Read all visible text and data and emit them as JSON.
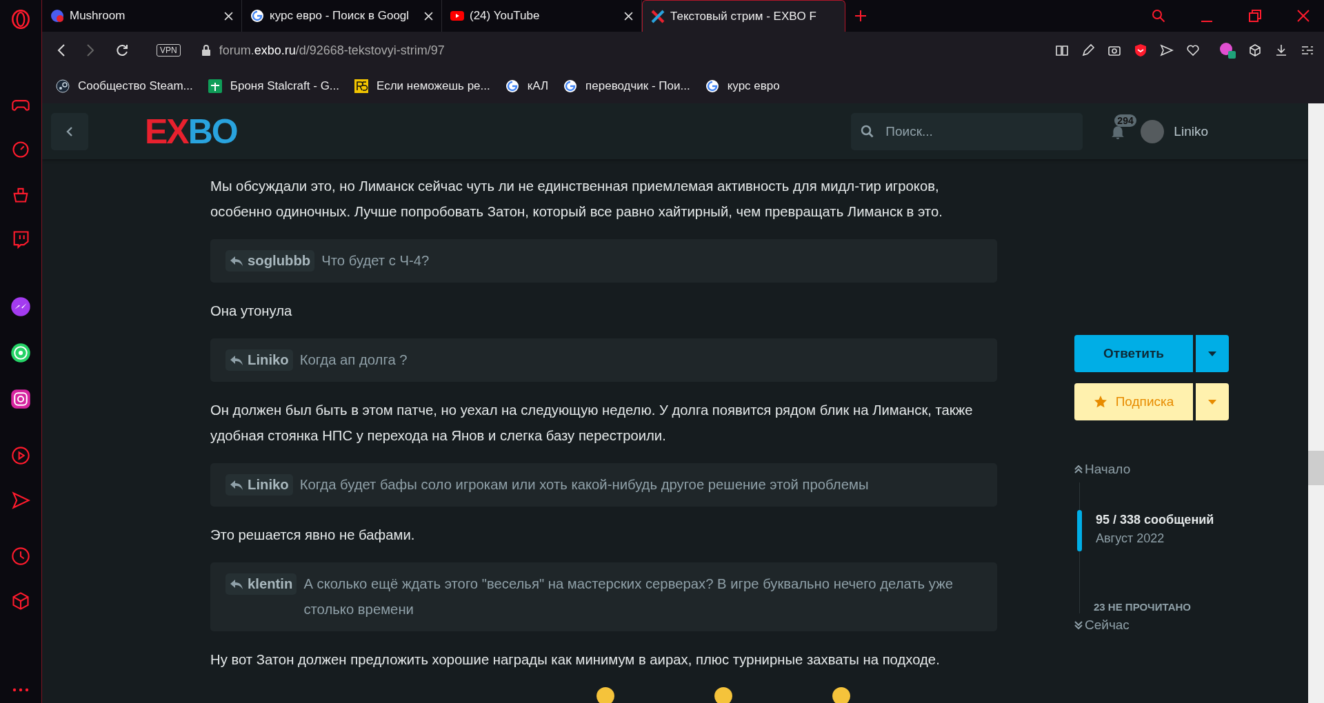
{
  "browser": {
    "tabs": [
      {
        "title": "Mushroom",
        "kind": "mushroom",
        "selected": false
      },
      {
        "title": "курс евро - Поиск в Googl",
        "kind": "google",
        "selected": false
      },
      {
        "title": "(24) YouTube",
        "kind": "youtube",
        "selected": false
      },
      {
        "title": "Текстовый стрим - EXBO F",
        "kind": "exbo",
        "selected": true
      }
    ],
    "vpn": "VPN",
    "url": "forum.**exbo.ru**/d/92668-tekstovyi-strim/97",
    "bookmarks": [
      {
        "title": "Сообщество Steam...",
        "kind": "steam"
      },
      {
        "title": "Броня Stalcraft - G...",
        "kind": "sheets"
      },
      {
        "title": "Если неможешь ре...",
        "kind": "r5"
      },
      {
        "title": "кАЛ",
        "kind": "google"
      },
      {
        "title": "переводчик - Пои...",
        "kind": "google"
      },
      {
        "title": "курс евро",
        "kind": "google"
      }
    ]
  },
  "forum": {
    "logo": "EXBO",
    "search": {
      "placeholder": "Поиск..."
    },
    "notifications": "294",
    "user": "Liniko",
    "posts": [
      {
        "kind": "paragraph",
        "text": "Мы обсуждали это, но Лиманск сейчас чуть ли не единственная приемлемая активность для мидл-тир игроков, особенно одиночных. Лучше попробовать Затон, который все равно хайтирный, чем превращать Лиманск в это."
      },
      {
        "kind": "quote",
        "user": "soglubbb",
        "text": "Что будет с Ч-4?"
      },
      {
        "kind": "paragraph",
        "text": "Она утонула"
      },
      {
        "kind": "quote",
        "user": "Liniko",
        "text": "Когда ап долга ?"
      },
      {
        "kind": "paragraph",
        "text": "Он должен был быть в этом патче, но уехал на следующую неделю. У долга появится рядом блик на Лиманск, также удобная стоянка НПС у перехода на Янов и слегка базу перестроили."
      },
      {
        "kind": "quote",
        "user": "Liniko",
        "text": "Когда будет бафы соло игрокам или хоть какой-нибудь другое решение этой проблемы"
      },
      {
        "kind": "paragraph",
        "text": "Это решается явно не бафами."
      },
      {
        "kind": "quote",
        "user": "klentin",
        "text": "А сколько ещё ждать этого \"веселья\" на мастерских серверах? В игре буквально нечего делать уже столько времени"
      },
      {
        "kind": "paragraph",
        "text": "Ну вот Затон должен предложить хорошие награды как минимум в аирах, плюс турнирные захваты на подходе."
      }
    ],
    "sidebar": {
      "reply": "Ответить",
      "follow": "Подписка",
      "start": "Начало",
      "count": "95 / 338 сообщений",
      "date": "Август 2022",
      "unread": "23 НЕ ПРОЧИТАНО",
      "now": "Сейчас"
    }
  }
}
